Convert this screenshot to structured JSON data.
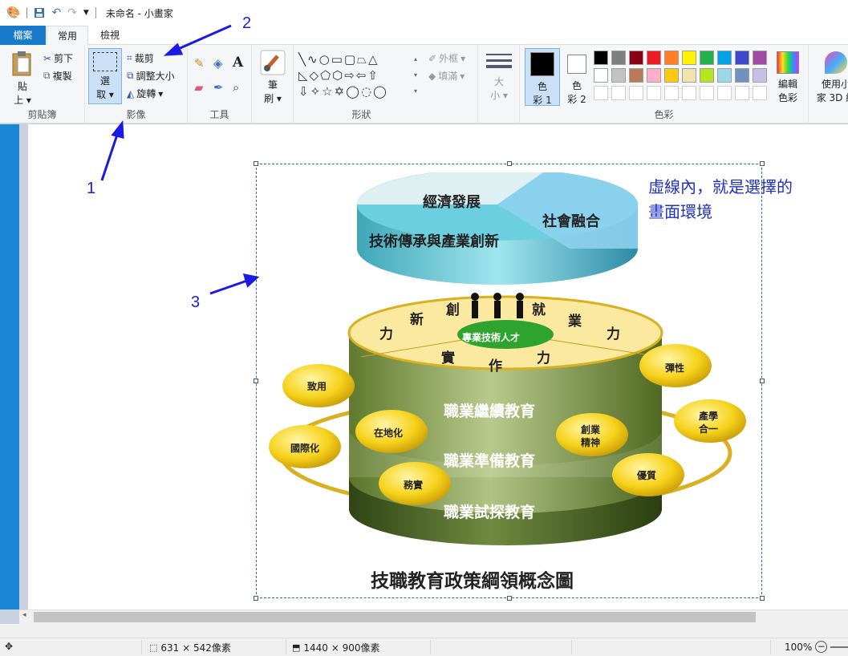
{
  "titlebar": {
    "title": "未命名 - 小畫家"
  },
  "tabs": {
    "file": "檔案",
    "home": "常用",
    "view": "檢視"
  },
  "clipboard": {
    "paste": "貼",
    "paste2": "上",
    "cut": "剪下",
    "copy": "複製",
    "group": "剪貼簿"
  },
  "image": {
    "select": "選",
    "select2": "取",
    "crop": "裁剪",
    "resize": "調整大小",
    "rotate": "旋轉",
    "group": "影像"
  },
  "tools": {
    "group": "工具",
    "text_tool": "A"
  },
  "brushes": {
    "label": "筆",
    "label2": "刷"
  },
  "shapes": {
    "outline": "外框",
    "fill": "填滿",
    "group": "形狀"
  },
  "size": {
    "label": "大",
    "label2": "小"
  },
  "colors": {
    "color1": "色",
    "color1b": "彩 1",
    "color2": "色",
    "color2b": "彩 2",
    "edit": "編輯",
    "edit2": "色彩",
    "group": "色彩",
    "row1": [
      "#000000",
      "#7f7f7f",
      "#880015",
      "#ed1c24",
      "#ff7f27",
      "#fff200",
      "#22b14c",
      "#00a2e8",
      "#3f48cc",
      "#a349a4"
    ],
    "row2": [
      "#ffffff",
      "#c3c3c3",
      "#b97a57",
      "#ffaec9",
      "#ffc90e",
      "#efe4b0",
      "#b5e61d",
      "#99d9ea",
      "#7092be",
      "#c8bfe7"
    ],
    "row3": [
      "#ffffff",
      "#ffffff",
      "#ffffff",
      "#ffffff",
      "#ffffff",
      "#ffffff",
      "#ffffff",
      "#ffffff",
      "#ffffff",
      "#ffffff"
    ]
  },
  "paint3d": {
    "label": "使用小",
    "label2": "家 3D 編"
  },
  "annotations": {
    "n1": "1",
    "n2": "2",
    "n3": "3",
    "note1": "虛線內，就是選擇的",
    "note2": "畫面環境"
  },
  "diagram": {
    "pie1": "經濟發展",
    "pie2": "社會融合",
    "pie3": "技術傳承與產業創新",
    "core": "專業技術人才",
    "c1": "創",
    "c2": "新",
    "c3": "力",
    "c4": "就",
    "c5": "業",
    "c6": "力",
    "c7": "實",
    "c8": "作",
    "c9": "力",
    "layer1": "職業繼續教育",
    "layer2": "職業準備教育",
    "layer3": "職業試探教育",
    "b1": "致用",
    "b2": "在地化",
    "b3": "國際化",
    "b4": "務實",
    "b5": "創業",
    "b5b": "精神",
    "b6": "優質",
    "b7": "產學",
    "b7b": "合一",
    "b8": "彈性",
    "title": "技職教育政策綱領概念圖"
  },
  "status": {
    "selection": "631 × 542像素",
    "canvas": "1440 × 900像素",
    "zoom": "100%"
  }
}
